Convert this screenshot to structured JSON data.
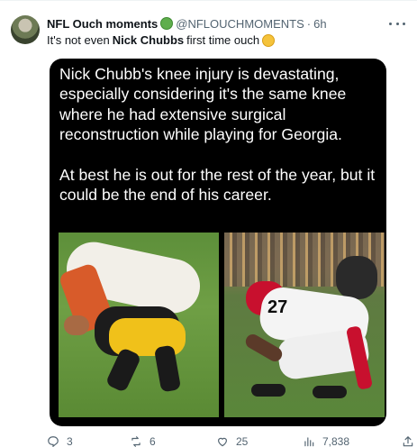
{
  "tweet": {
    "display_name": "NFL Ouch moments",
    "handle": "@NFLOUCHMOMENTS",
    "time": "6h",
    "text_before": "It's not even",
    "text_bold": "Nick Chubbs",
    "text_after": "first time ouch",
    "name_emoji": "nauseated-face-icon",
    "text_emoji": "grimacing-face-icon"
  },
  "media": {
    "paragraphs": [
      "Nick Chubb's knee injury is devastating, especially considering it's the same knee where he had extensive surgical reconstruction while playing for Georgia.",
      "At best he is out for the rest of the year, but it could be the end of his career."
    ],
    "left_photo": "browns-steelers-tackle-photo",
    "right_photo": "georgia-player-injury-photo",
    "jersey_number": "27"
  },
  "actions": {
    "replies": "3",
    "reposts": "6",
    "likes": "25",
    "views": "7,838"
  },
  "colors": {
    "text": "#0f1419",
    "secondary": "#536471",
    "media_bg": "#000000"
  }
}
